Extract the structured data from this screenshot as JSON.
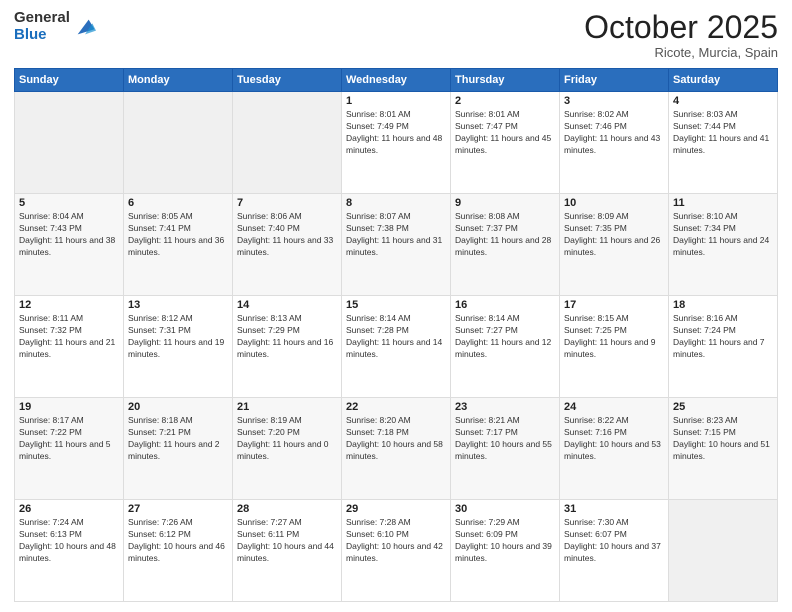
{
  "header": {
    "logo_general": "General",
    "logo_blue": "Blue",
    "month_title": "October 2025",
    "location": "Ricote, Murcia, Spain"
  },
  "days_of_week": [
    "Sunday",
    "Monday",
    "Tuesday",
    "Wednesday",
    "Thursday",
    "Friday",
    "Saturday"
  ],
  "weeks": [
    [
      {
        "day": "",
        "sunrise": "",
        "sunset": "",
        "daylight": ""
      },
      {
        "day": "",
        "sunrise": "",
        "sunset": "",
        "daylight": ""
      },
      {
        "day": "",
        "sunrise": "",
        "sunset": "",
        "daylight": ""
      },
      {
        "day": "1",
        "sunrise": "Sunrise: 8:01 AM",
        "sunset": "Sunset: 7:49 PM",
        "daylight": "Daylight: 11 hours and 48 minutes."
      },
      {
        "day": "2",
        "sunrise": "Sunrise: 8:01 AM",
        "sunset": "Sunset: 7:47 PM",
        "daylight": "Daylight: 11 hours and 45 minutes."
      },
      {
        "day": "3",
        "sunrise": "Sunrise: 8:02 AM",
        "sunset": "Sunset: 7:46 PM",
        "daylight": "Daylight: 11 hours and 43 minutes."
      },
      {
        "day": "4",
        "sunrise": "Sunrise: 8:03 AM",
        "sunset": "Sunset: 7:44 PM",
        "daylight": "Daylight: 11 hours and 41 minutes."
      }
    ],
    [
      {
        "day": "5",
        "sunrise": "Sunrise: 8:04 AM",
        "sunset": "Sunset: 7:43 PM",
        "daylight": "Daylight: 11 hours and 38 minutes."
      },
      {
        "day": "6",
        "sunrise": "Sunrise: 8:05 AM",
        "sunset": "Sunset: 7:41 PM",
        "daylight": "Daylight: 11 hours and 36 minutes."
      },
      {
        "day": "7",
        "sunrise": "Sunrise: 8:06 AM",
        "sunset": "Sunset: 7:40 PM",
        "daylight": "Daylight: 11 hours and 33 minutes."
      },
      {
        "day": "8",
        "sunrise": "Sunrise: 8:07 AM",
        "sunset": "Sunset: 7:38 PM",
        "daylight": "Daylight: 11 hours and 31 minutes."
      },
      {
        "day": "9",
        "sunrise": "Sunrise: 8:08 AM",
        "sunset": "Sunset: 7:37 PM",
        "daylight": "Daylight: 11 hours and 28 minutes."
      },
      {
        "day": "10",
        "sunrise": "Sunrise: 8:09 AM",
        "sunset": "Sunset: 7:35 PM",
        "daylight": "Daylight: 11 hours and 26 minutes."
      },
      {
        "day": "11",
        "sunrise": "Sunrise: 8:10 AM",
        "sunset": "Sunset: 7:34 PM",
        "daylight": "Daylight: 11 hours and 24 minutes."
      }
    ],
    [
      {
        "day": "12",
        "sunrise": "Sunrise: 8:11 AM",
        "sunset": "Sunset: 7:32 PM",
        "daylight": "Daylight: 11 hours and 21 minutes."
      },
      {
        "day": "13",
        "sunrise": "Sunrise: 8:12 AM",
        "sunset": "Sunset: 7:31 PM",
        "daylight": "Daylight: 11 hours and 19 minutes."
      },
      {
        "day": "14",
        "sunrise": "Sunrise: 8:13 AM",
        "sunset": "Sunset: 7:29 PM",
        "daylight": "Daylight: 11 hours and 16 minutes."
      },
      {
        "day": "15",
        "sunrise": "Sunrise: 8:14 AM",
        "sunset": "Sunset: 7:28 PM",
        "daylight": "Daylight: 11 hours and 14 minutes."
      },
      {
        "day": "16",
        "sunrise": "Sunrise: 8:14 AM",
        "sunset": "Sunset: 7:27 PM",
        "daylight": "Daylight: 11 hours and 12 minutes."
      },
      {
        "day": "17",
        "sunrise": "Sunrise: 8:15 AM",
        "sunset": "Sunset: 7:25 PM",
        "daylight": "Daylight: 11 hours and 9 minutes."
      },
      {
        "day": "18",
        "sunrise": "Sunrise: 8:16 AM",
        "sunset": "Sunset: 7:24 PM",
        "daylight": "Daylight: 11 hours and 7 minutes."
      }
    ],
    [
      {
        "day": "19",
        "sunrise": "Sunrise: 8:17 AM",
        "sunset": "Sunset: 7:22 PM",
        "daylight": "Daylight: 11 hours and 5 minutes."
      },
      {
        "day": "20",
        "sunrise": "Sunrise: 8:18 AM",
        "sunset": "Sunset: 7:21 PM",
        "daylight": "Daylight: 11 hours and 2 minutes."
      },
      {
        "day": "21",
        "sunrise": "Sunrise: 8:19 AM",
        "sunset": "Sunset: 7:20 PM",
        "daylight": "Daylight: 11 hours and 0 minutes."
      },
      {
        "day": "22",
        "sunrise": "Sunrise: 8:20 AM",
        "sunset": "Sunset: 7:18 PM",
        "daylight": "Daylight: 10 hours and 58 minutes."
      },
      {
        "day": "23",
        "sunrise": "Sunrise: 8:21 AM",
        "sunset": "Sunset: 7:17 PM",
        "daylight": "Daylight: 10 hours and 55 minutes."
      },
      {
        "day": "24",
        "sunrise": "Sunrise: 8:22 AM",
        "sunset": "Sunset: 7:16 PM",
        "daylight": "Daylight: 10 hours and 53 minutes."
      },
      {
        "day": "25",
        "sunrise": "Sunrise: 8:23 AM",
        "sunset": "Sunset: 7:15 PM",
        "daylight": "Daylight: 10 hours and 51 minutes."
      }
    ],
    [
      {
        "day": "26",
        "sunrise": "Sunrise: 7:24 AM",
        "sunset": "Sunset: 6:13 PM",
        "daylight": "Daylight: 10 hours and 48 minutes."
      },
      {
        "day": "27",
        "sunrise": "Sunrise: 7:26 AM",
        "sunset": "Sunset: 6:12 PM",
        "daylight": "Daylight: 10 hours and 46 minutes."
      },
      {
        "day": "28",
        "sunrise": "Sunrise: 7:27 AM",
        "sunset": "Sunset: 6:11 PM",
        "daylight": "Daylight: 10 hours and 44 minutes."
      },
      {
        "day": "29",
        "sunrise": "Sunrise: 7:28 AM",
        "sunset": "Sunset: 6:10 PM",
        "daylight": "Daylight: 10 hours and 42 minutes."
      },
      {
        "day": "30",
        "sunrise": "Sunrise: 7:29 AM",
        "sunset": "Sunset: 6:09 PM",
        "daylight": "Daylight: 10 hours and 39 minutes."
      },
      {
        "day": "31",
        "sunrise": "Sunrise: 7:30 AM",
        "sunset": "Sunset: 6:07 PM",
        "daylight": "Daylight: 10 hours and 37 minutes."
      },
      {
        "day": "",
        "sunrise": "",
        "sunset": "",
        "daylight": ""
      }
    ]
  ]
}
